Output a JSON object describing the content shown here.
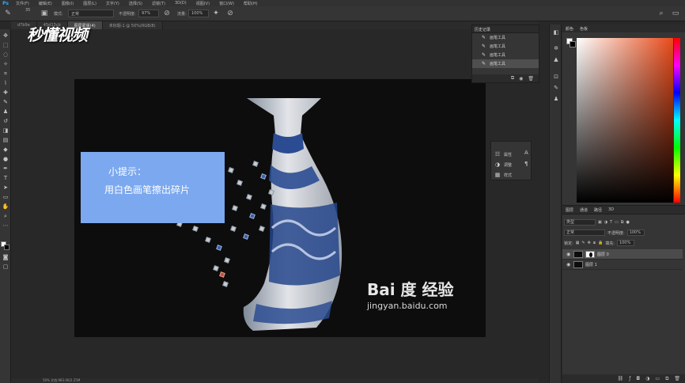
{
  "app": {
    "logo": "Ps"
  },
  "menu": [
    "文件(F)",
    "编辑(E)",
    "图像(I)",
    "图层(L)",
    "文字(Y)",
    "选择(S)",
    "滤镜(T)",
    "3D(D)",
    "视图(V)",
    "窗口(W)",
    "帮助(H)"
  ],
  "options": {
    "brush_size": "35",
    "mode_label": "模式:",
    "mode_value": "正常",
    "opacity_label": "不透明度:",
    "opacity_value": "97%",
    "flow_label": "流量:",
    "flow_value": "100%"
  },
  "tabs": [
    {
      "label": "d7b9e",
      "active": false
    },
    {
      "label": "45d13cb",
      "active": false
    },
    {
      "label": "图层蒙版(4)",
      "active": true
    },
    {
      "label": "未标题-1 @ 50%(RGB/8)",
      "active": false
    }
  ],
  "brand": {
    "text": "秒懂视频"
  },
  "canvas": {
    "tip_title": "小提示：",
    "tip_text": "用白色画笔擦出碎片",
    "watermark_main": "Bai 度 经验",
    "watermark_sub": "jingyan.baidu.com"
  },
  "history": {
    "title": "历史记录",
    "items": [
      {
        "label": "画笔工具",
        "selected": false
      },
      {
        "label": "画笔工具",
        "selected": false
      },
      {
        "label": "画笔工具",
        "selected": false
      },
      {
        "label": "画笔工具",
        "selected": true
      }
    ]
  },
  "properties": {
    "items": [
      "属性",
      "调整",
      "样式"
    ]
  },
  "color": {
    "tabs": [
      "颜色",
      "色板"
    ],
    "foreground": "#ffffff",
    "background": "#000000",
    "hue": "#e84b1a"
  },
  "layers": {
    "tabs": [
      "图层",
      "通道",
      "路径",
      "3D"
    ],
    "filter_label": "类型",
    "blend_mode": "正常",
    "opacity_label": "不透明度:",
    "opacity_value": "100%",
    "lock_label": "锁定:",
    "fill_label": "填充:",
    "fill_value": "100%",
    "items": [
      {
        "name": "图层 0",
        "selected": true,
        "has_mask": true
      },
      {
        "name": "图层 1",
        "selected": false,
        "has_mask": false
      }
    ]
  },
  "status": {
    "text": "50% 文档:983.0K/2.25M"
  }
}
